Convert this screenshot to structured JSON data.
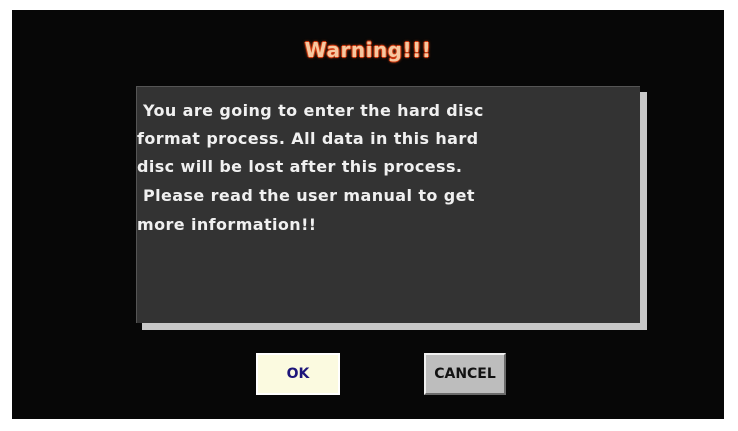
{
  "dialog": {
    "title": "Warning!!!",
    "message_lines": [
      " You are going to enter the hard disc",
      "format process. All data in this hard",
      "disc will be lost after this process.",
      " Please read the user manual to get",
      "more information!!"
    ]
  },
  "buttons": {
    "ok_label": "OK",
    "cancel_label": "CANCEL"
  },
  "colors": {
    "screen_bg": "#070707",
    "title_glow": "#d23a10",
    "message_bg": "#333333",
    "ok_bg": "#fbfae0",
    "ok_text": "#1d157a",
    "cancel_bg": "#bdbdbd"
  }
}
